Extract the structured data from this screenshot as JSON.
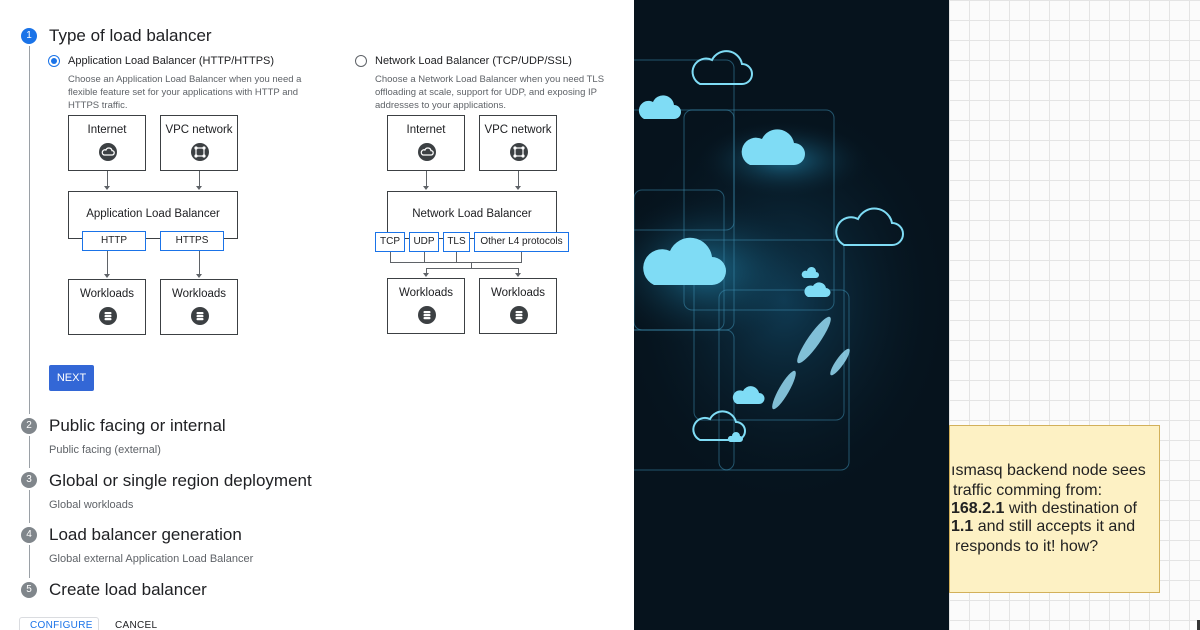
{
  "steps": [
    {
      "number": "1",
      "title": "Type of load balancer",
      "subtitle": ""
    },
    {
      "number": "2",
      "title": "Public facing or internal",
      "subtitle": "Public facing (external)"
    },
    {
      "number": "3",
      "title": "Global or single region deployment",
      "subtitle": "Global workloads"
    },
    {
      "number": "4",
      "title": "Load balancer generation",
      "subtitle": "Global external Application Load Balancer"
    },
    {
      "number": "5",
      "title": "Create load balancer",
      "subtitle": ""
    }
  ],
  "options": {
    "application": {
      "selected": true,
      "label": "Application Load Balancer (HTTP/HTTPS)",
      "desc_lines": [
        "Choose an Application Load Balancer when you need a",
        "flexible feature set for your applications with HTTP and",
        "HTTPS traffic."
      ],
      "diagram": {
        "top_left": "Internet",
        "top_right": "VPC network",
        "middle": "Application Load Balancer",
        "protocols": [
          "HTTP",
          "HTTPS"
        ],
        "bottom_left": "Workloads",
        "bottom_right": "Workloads"
      }
    },
    "network": {
      "selected": false,
      "label": "Network Load Balancer (TCP/UDP/SSL)",
      "desc_lines": [
        "Choose a Network Load Balancer when you need TLS",
        "offloading at scale, support for UDP, and exposing IP",
        "addresses to your applications."
      ],
      "diagram": {
        "top_left": "Internet",
        "top_right": "VPC network",
        "middle": "Network Load Balancer",
        "protocols": [
          "TCP",
          "UDP",
          "TLS",
          "Other L4 protocols"
        ],
        "bottom_left": "Workloads",
        "bottom_right": "Workloads"
      }
    }
  },
  "buttons": {
    "next": "NEXT",
    "configure": "CONFIGURE",
    "cancel": "CANCEL"
  },
  "note": {
    "line1": "ısmasq backend node sees",
    "line2": "traffic comming from:",
    "line3_bold": "168.2.1",
    "line3_rest": " with destination of",
    "line4_bold": "1.1",
    "line4_rest": " and still accepts it and",
    "line5": "responds to it! how?"
  },
  "colors": {
    "accent": "#1a73e8",
    "button": "#3367d6",
    "mid_bg": "#06131d",
    "cloud": "#7fdcf5",
    "note_bg": "#fdf1c4"
  }
}
